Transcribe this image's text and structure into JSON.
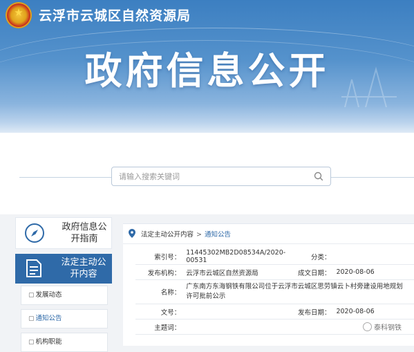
{
  "header": {
    "agency_name": "云浮市云城区自然资源局",
    "banner_title": "政府信息公开"
  },
  "search": {
    "placeholder": "请输入搜索关键词",
    "icon": "search-icon"
  },
  "sidebar": {
    "guide": {
      "label": "政府信息公开指南",
      "icon": "compass-icon"
    },
    "active": {
      "label": "法定主动公开内容",
      "icon": "document-icon"
    },
    "items": [
      {
        "label": "发展动态",
        "icon": "document-icon"
      },
      {
        "label": "通知公告",
        "icon": "document-icon"
      },
      {
        "label": "机构职能",
        "icon": "document-icon"
      }
    ]
  },
  "breadcrumb": {
    "icon": "map-pin-icon",
    "parent": "法定主动公开内容",
    "separator": ">",
    "current": "通知公告"
  },
  "document": {
    "index_label": "索引号：",
    "index_value": "11445302MB2D08534A/2020-00531",
    "category_label": "分类：",
    "category_value": "",
    "publisher_label": "发布机构：",
    "publisher_value": "云浮市云城区自然资源局",
    "created_label": "成文日期：",
    "created_value": "2020-08-06",
    "title_label": "名称：",
    "title_value": "广东南方东海钢铁有限公司位于云浮市云城区思劳镇云卜村旁建设用地规划许可批前公示",
    "docno_label": "文号：",
    "docno_value": "",
    "pubdate_label": "发布日期：",
    "pubdate_value": "2020-08-06",
    "subject_label": "主题词：",
    "subject_value": ""
  },
  "watermark": {
    "text": "泰科钢铁"
  },
  "colors": {
    "primary": "#2f6aa8",
    "banner_top": "#3c7fc1",
    "background": "#f1f3f6"
  }
}
